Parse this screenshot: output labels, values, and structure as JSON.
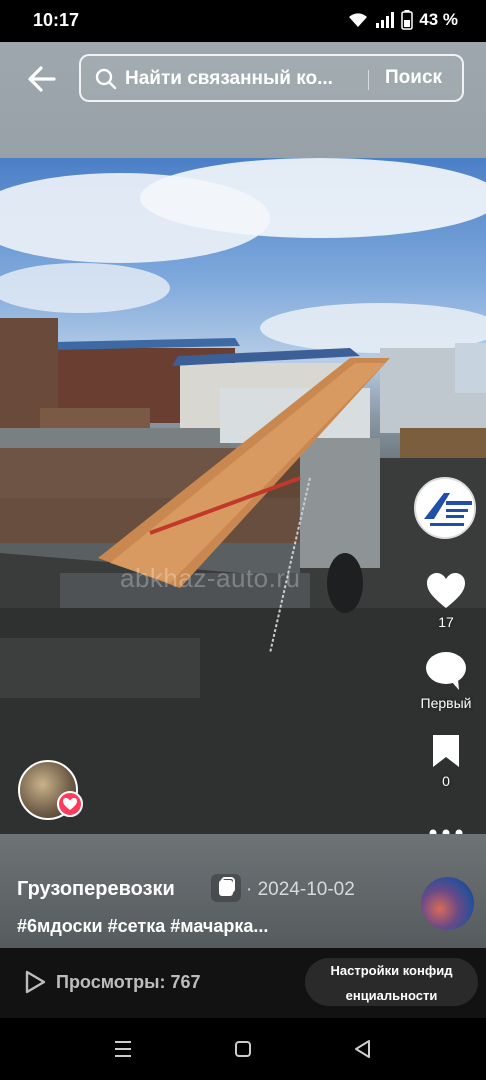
{
  "status_bar": {
    "time": "10:17",
    "battery": "43 %"
  },
  "header": {
    "search_placeholder": "Найти связанный ко...",
    "search_button": "Поиск"
  },
  "video": {
    "watermark": "abkhaz-auto.ru"
  },
  "actions": {
    "like_count": "17",
    "comment_label": "Первый",
    "save_count": "0"
  },
  "info": {
    "channel_name": "Грузоперевозки",
    "date": "· 2024-10-02",
    "hashtags": "#6мдоски #сетка #мачарка..."
  },
  "bottom": {
    "views": "Просмотры: 767",
    "privacy_line1": "Настройки конфид",
    "privacy_line2": "енциальности"
  },
  "colors": {
    "like_badge": "#ff3b5c",
    "panel": "#62676a"
  }
}
